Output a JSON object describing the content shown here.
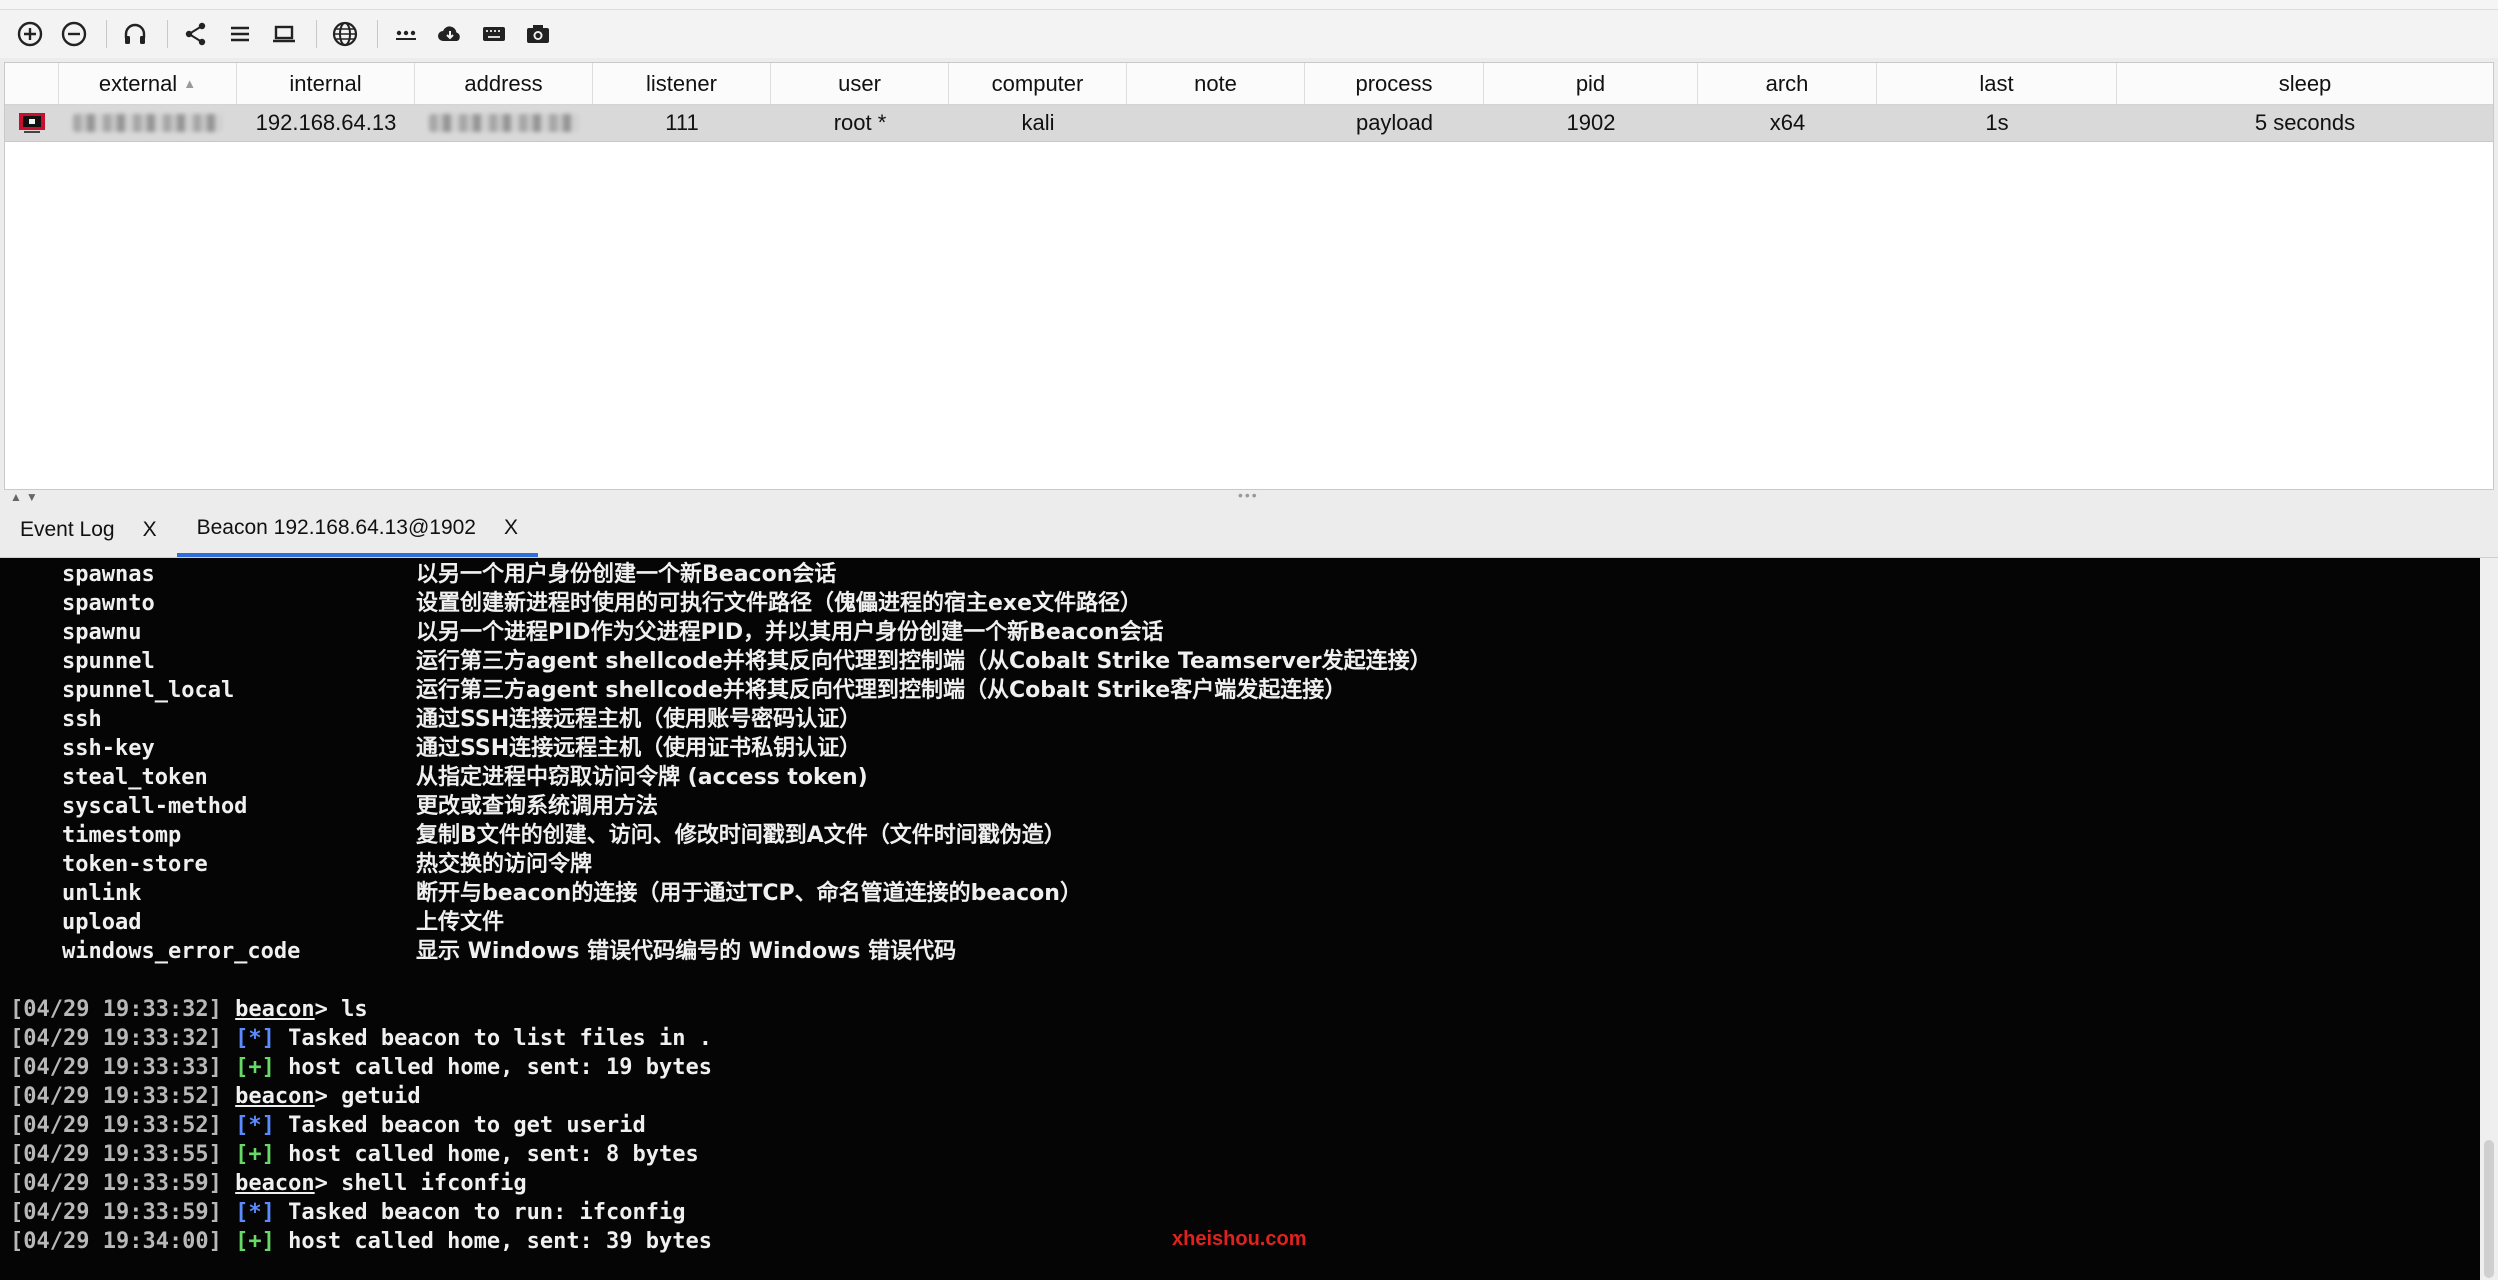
{
  "table": {
    "headers": [
      "external",
      "internal",
      "address",
      "listener",
      "user",
      "computer",
      "note",
      "process",
      "pid",
      "arch",
      "last",
      "sleep"
    ],
    "sorted_column": "external",
    "rows": [
      {
        "external": "",
        "internal": "192.168.64.13",
        "address": "",
        "listener": "111",
        "user": "root *",
        "computer": "kali",
        "note": "",
        "process": "payload",
        "pid": "1902",
        "arch": "x64",
        "last": "1s",
        "sleep": "5 seconds"
      }
    ]
  },
  "tabs": [
    {
      "label": "Event Log",
      "close": "X"
    },
    {
      "label": "Beacon 192.168.64.13@1902",
      "close": "X"
    }
  ],
  "active_tab": 1,
  "console": {
    "help": [
      {
        "cmd": "spawnas",
        "desc": "以另一个用户身份创建一个新Beacon会话"
      },
      {
        "cmd": "spawnto",
        "desc": "设置创建新进程时使用的可执行文件路径（傀儡进程的宿主exe文件路径）"
      },
      {
        "cmd": "spawnu",
        "desc": "以另一个进程PID作为父进程PID，并以其用户身份创建一个新Beacon会话"
      },
      {
        "cmd": "spunnel",
        "desc": "运行第三方agent shellcode并将其反向代理到控制端（从Cobalt Strike Teamserver发起连接）"
      },
      {
        "cmd": "spunnel_local",
        "desc": "运行第三方agent shellcode并将其反向代理到控制端（从Cobalt Strike客户端发起连接）"
      },
      {
        "cmd": "ssh",
        "desc": "通过SSH连接远程主机（使用账号密码认证）"
      },
      {
        "cmd": "ssh-key",
        "desc": "通过SSH连接远程主机（使用证书私钥认证）"
      },
      {
        "cmd": "steal_token",
        "desc": "从指定进程中窃取访问令牌 (access token)"
      },
      {
        "cmd": "syscall-method",
        "desc": "更改或查询系统调用方法"
      },
      {
        "cmd": "timestomp",
        "desc": "复制B文件的创建、访问、修改时间戳到A文件（文件时间戳伪造）"
      },
      {
        "cmd": "token-store",
        "desc": "热交换的访问令牌"
      },
      {
        "cmd": "unlink",
        "desc": "断开与beacon的连接（用于通过TCP、命名管道连接的beacon）"
      },
      {
        "cmd": "upload",
        "desc": "上传文件"
      },
      {
        "cmd": "windows_error_code",
        "desc": "显示 Windows 错误代码编号的 Windows 错误代码"
      }
    ],
    "log": [
      {
        "ts": "[04/29 19:33:32]",
        "kind": "prompt",
        "prompt": "beacon",
        "text": "> ls"
      },
      {
        "ts": "[04/29 19:33:32]",
        "kind": "info",
        "tag": "[*]",
        "text": " Tasked beacon to list files in ."
      },
      {
        "ts": "[04/29 19:33:33]",
        "kind": "ok",
        "tag": "[+]",
        "text": " host called home, sent: 19 bytes"
      },
      {
        "ts": "[04/29 19:33:52]",
        "kind": "prompt",
        "prompt": "beacon",
        "text": "> getuid"
      },
      {
        "ts": "[04/29 19:33:52]",
        "kind": "info",
        "tag": "[*]",
        "text": " Tasked beacon to get userid"
      },
      {
        "ts": "[04/29 19:33:55]",
        "kind": "ok",
        "tag": "[+]",
        "text": " host called home, sent: 8 bytes"
      },
      {
        "ts": "[04/29 19:33:59]",
        "kind": "prompt",
        "prompt": "beacon",
        "text": "> shell ifconfig"
      },
      {
        "ts": "[04/29 19:33:59]",
        "kind": "info",
        "tag": "[*]",
        "text": " Tasked beacon to run: ifconfig"
      },
      {
        "ts": "[04/29 19:34:00]",
        "kind": "ok",
        "tag": "[+]",
        "text": " host called home, sent: 39 bytes"
      }
    ],
    "watermark": "xheishou.com"
  },
  "toolbar_icons": [
    "plus-circle-icon",
    "minus-circle-icon",
    "headphones-icon",
    "share-icon",
    "list-icon",
    "laptop-icon",
    "globe-icon",
    "dots-icon",
    "cloud-download-icon",
    "keyboard-icon",
    "camera-icon"
  ]
}
